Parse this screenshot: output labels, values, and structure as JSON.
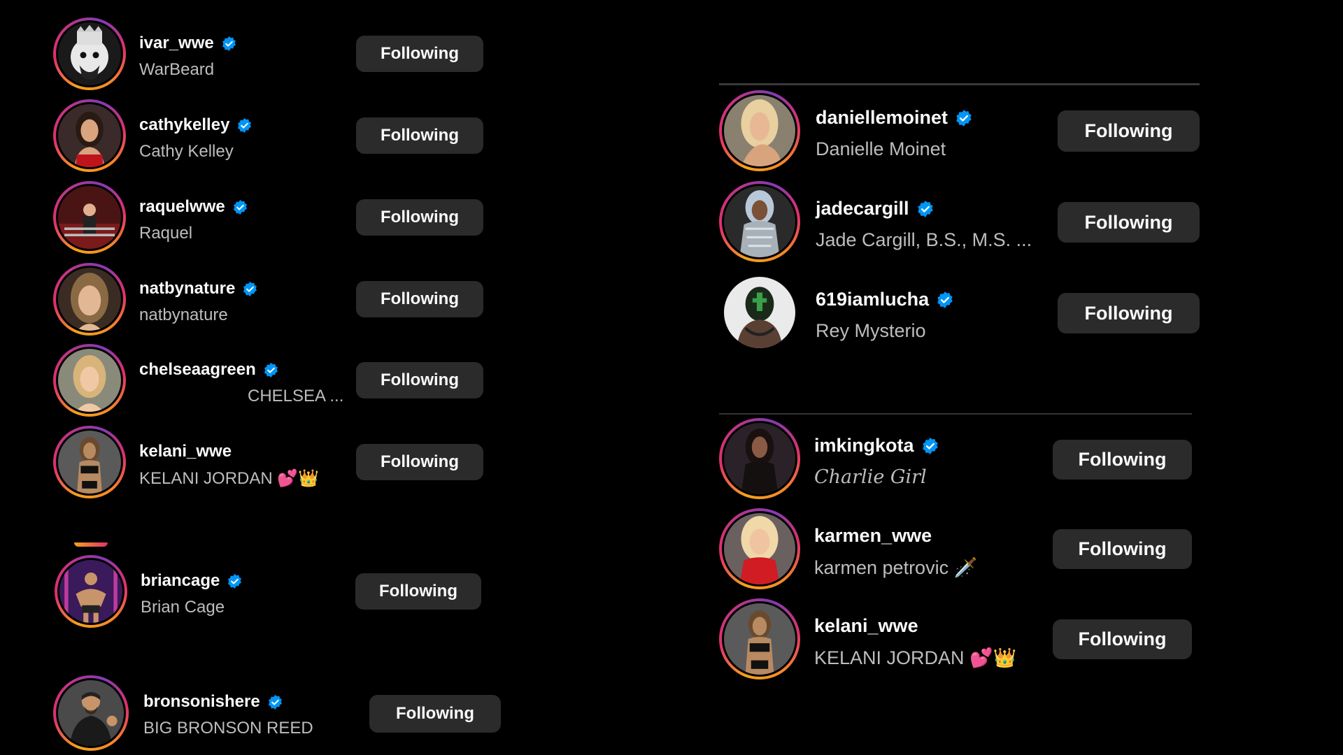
{
  "left_list": [
    {
      "username": "ivar_wwe",
      "full_name": "WarBeard",
      "verified": true,
      "button": "Following",
      "avatar": "masked-wrestler-avatar"
    },
    {
      "username": "cathykelley",
      "full_name": "Cathy Kelley",
      "verified": true,
      "button": "Following",
      "avatar": "woman-red-dress-avatar"
    },
    {
      "username": "raquelwwe",
      "full_name": "Raquel",
      "verified": true,
      "button": "Following",
      "avatar": "ring-entrance-avatar"
    },
    {
      "username": "natbynature",
      "full_name": "natbynature",
      "verified": true,
      "button": "Following",
      "avatar": "woman-portrait-avatar"
    },
    {
      "username": "chelseaagreen",
      "full_name": "CHELSEA ...",
      "verified": true,
      "button": "Following",
      "avatar": "blonde-woman-avatar"
    },
    {
      "username": "kelani_wwe",
      "full_name": "KELANI JORDAN 💕👑",
      "verified": false,
      "button": "Following",
      "avatar": "wrestler-woman-avatar"
    },
    {
      "username": "briancage",
      "full_name": "Brian Cage",
      "verified": true,
      "button": "Following",
      "avatar": "muscular-wrestler-avatar"
    },
    {
      "username": "bronsonishere",
      "full_name": "BIG BRONSON REED",
      "verified": true,
      "button": "Following",
      "avatar": "bearded-wrestler-avatar"
    }
  ],
  "right_list_top": [
    {
      "username": "daniellemoinet",
      "full_name": "Danielle Moinet",
      "verified": true,
      "button": "Following",
      "avatar": "blonde-woman-avatar"
    },
    {
      "username": "jadecargill",
      "full_name": "Jade Cargill, B.S., M.S. ...",
      "verified": true,
      "button": "Following",
      "avatar": "silver-outfit-avatar"
    },
    {
      "username": "619iamlucha",
      "full_name": "Rey Mysterio",
      "verified": true,
      "button": "Following",
      "avatar": "masked-luchador-avatar"
    }
  ],
  "right_list_bottom": [
    {
      "username": "imkingkota",
      "full_name": "Charlie Girl",
      "verified": true,
      "button": "Following",
      "avatar": "dark-hair-woman-avatar"
    },
    {
      "username": "karmen_wwe",
      "full_name": "karmen petrovic 🗡️",
      "verified": false,
      "button": "Following",
      "avatar": "blonde-red-top-avatar"
    },
    {
      "username": "kelani_wwe",
      "full_name": "KELANI JORDAN 💕👑",
      "verified": false,
      "button": "Following",
      "avatar": "wrestler-woman-avatar"
    }
  ],
  "colors": {
    "background": "#000000",
    "button": "#2b2b2b",
    "verified": "#0095f6",
    "secondary_text": "#bdbdbd"
  }
}
